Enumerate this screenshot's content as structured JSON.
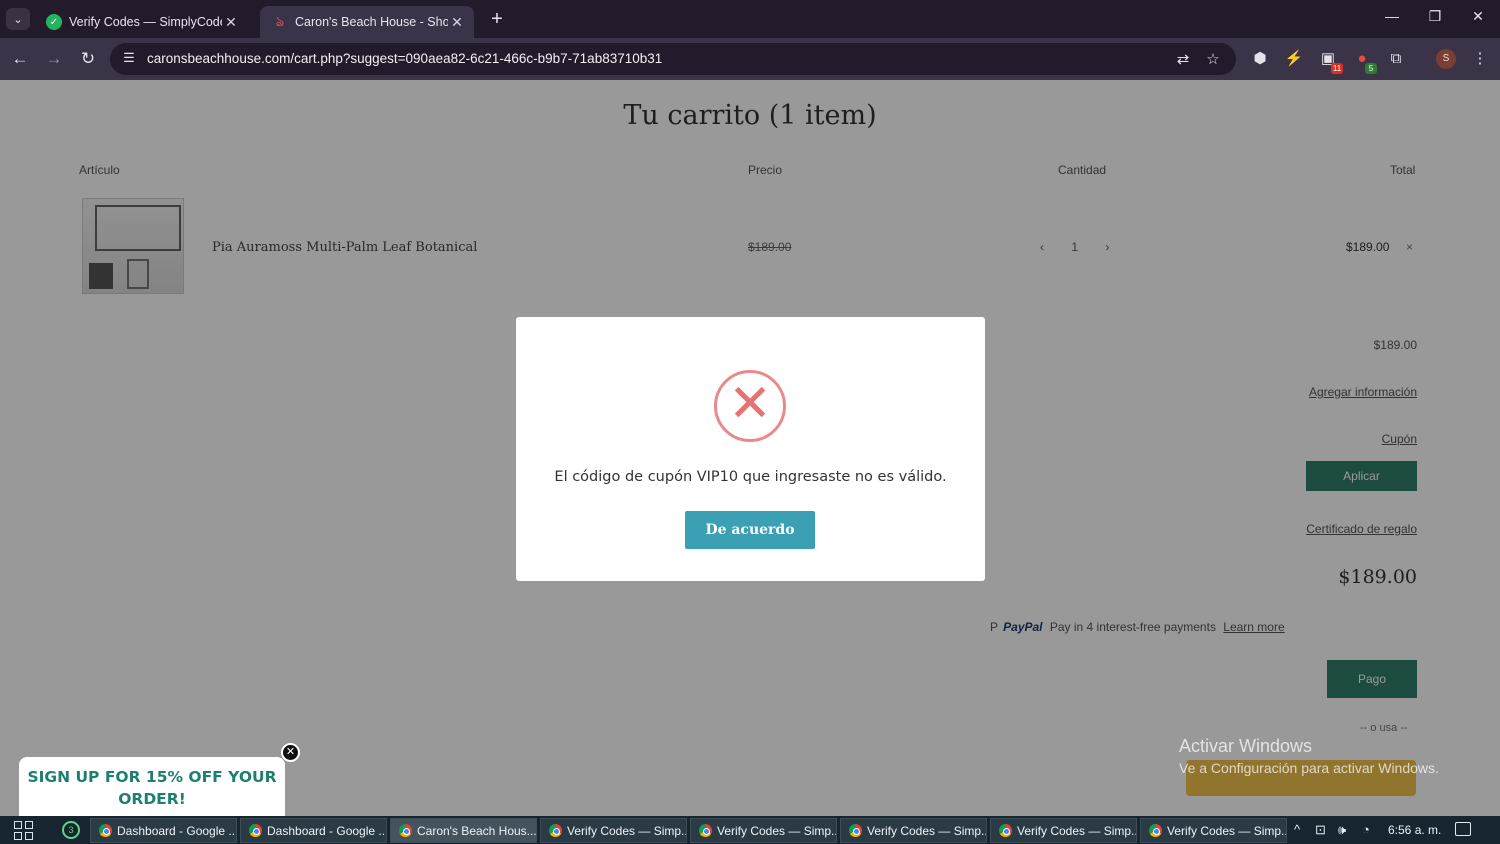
{
  "browser": {
    "tabs": [
      {
        "title": "Verify Codes — SimplyCodes",
        "favicon": "simplycodes-icon"
      },
      {
        "title": "Caron's Beach House - Shoppin",
        "favicon": "caronsbeachhouse-icon"
      }
    ],
    "url": "caronsbeachhouse.com/cart.php?suggest=090aea82-6c21-466c-b9b7-71ab83710b31",
    "extension_badges": {
      "ext1": "11",
      "ext2": "5"
    },
    "profile_initial": "S"
  },
  "cart": {
    "title": "Tu carrito (1 item)",
    "columns": {
      "item": "Artículo",
      "price": "Precio",
      "quantity": "Cantidad",
      "total": "Total"
    },
    "product": {
      "name": "Pia Auramoss Multi-Palm Leaf Botanical",
      "price": "$189.00",
      "quantity": "1",
      "total": "$189.00",
      "remove": "×"
    },
    "summary": {
      "subtotal": "$189.00",
      "shipping_link": "Agregar información",
      "coupon_link": "Cupón",
      "apply_button": "Aplicar",
      "gift_link": "Certificado de regalo",
      "grand_total": "$189.00",
      "paypal_text": "Pay in 4 interest-free payments",
      "paypal_brand": "PayPal",
      "paypal_link": "Learn more",
      "checkout_button": "Pago",
      "or_text": "-- o usa --"
    }
  },
  "modal": {
    "message": "El código de cupón VIP10 que ingresaste no es válido.",
    "button_label": "De acuerdo",
    "icon": "error-x-icon"
  },
  "popup": {
    "text": "SIGN UP FOR 15% OFF YOUR ORDER!"
  },
  "watermark": {
    "line1": "Activar Windows",
    "line2": "Ve a Configuración para activar Windows."
  },
  "taskbar": {
    "whatsapp_badge": "3",
    "items": [
      {
        "label": "Dashboard - Google ..."
      },
      {
        "label": "Dashboard - Google ..."
      },
      {
        "label": "Caron's Beach Hous..."
      },
      {
        "label": "Verify Codes — Simp..."
      },
      {
        "label": "Verify Codes — Simp..."
      },
      {
        "label": "Verify Codes — Simp..."
      },
      {
        "label": "Verify Codes — Simp..."
      },
      {
        "label": "Verify Codes — Simp..."
      }
    ],
    "clock": "6:56 a. m."
  }
}
